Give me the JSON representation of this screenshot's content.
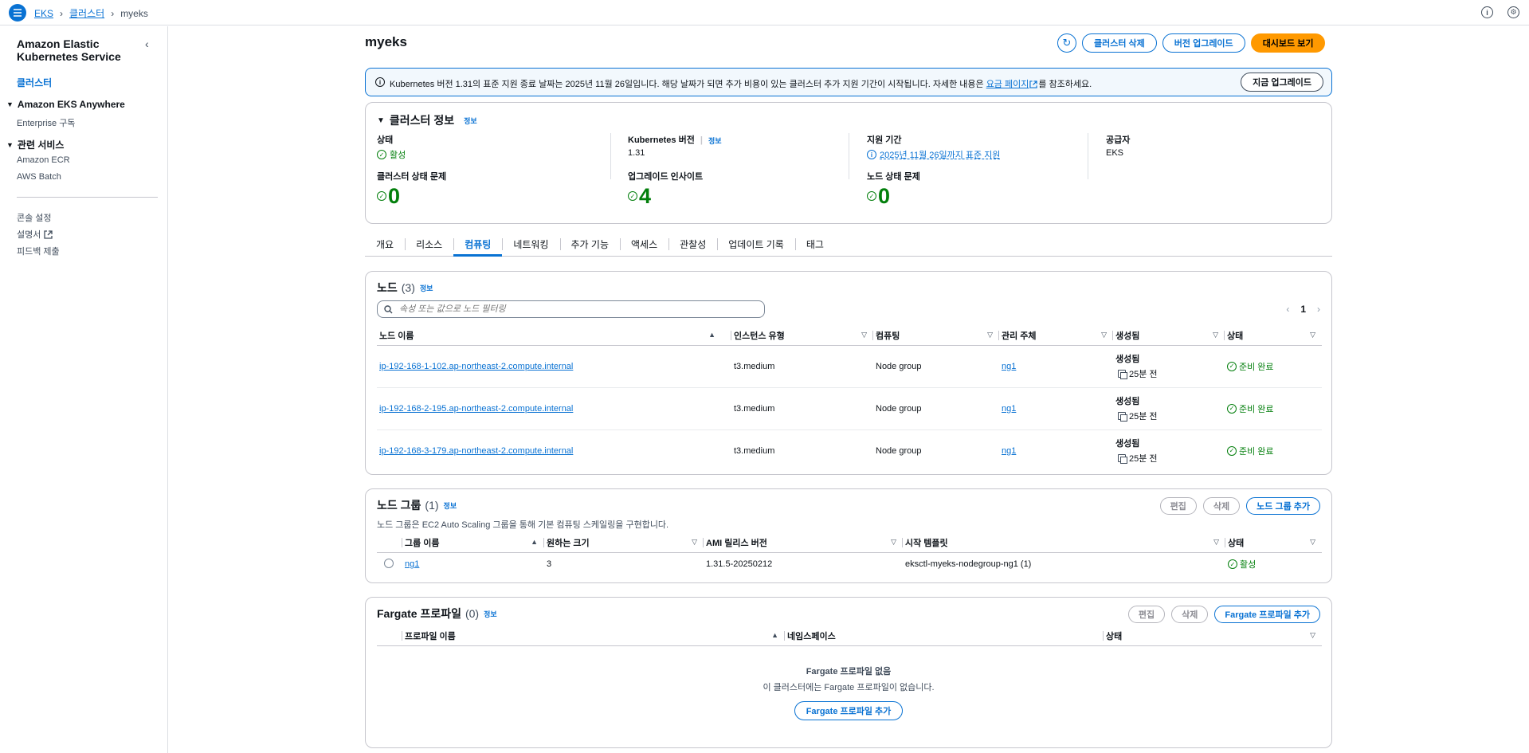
{
  "topbar": {
    "breadcrumb": [
      "EKS",
      "클러스터",
      "myeks"
    ]
  },
  "sidebar": {
    "title": "Amazon Elastic Kubernetes Service",
    "active_link": "클러스터",
    "sections": [
      {
        "label": "Amazon EKS Anywhere",
        "items": [
          "Enterprise 구독"
        ]
      },
      {
        "label": "관련 서비스",
        "items": [
          "Amazon ECR",
          "AWS Batch"
        ]
      }
    ],
    "footer_items": [
      "콘솔 설정",
      "설명서",
      "피드백 제출"
    ]
  },
  "header": {
    "title": "myeks",
    "delete_label": "클러스터 삭제",
    "upgrade_label": "버전 업그레이드",
    "dashboard_label": "대시보드 보기"
  },
  "banner": {
    "text_before": "Kubernetes 버전 1.31의 표준 지원 종료 날짜는 2025년 11월 26일입니다. 해당 날짜가 되면 추가 비용이 있는 클러스터 추가 지원 기간이 시작됩니다. 자세한 내용은 ",
    "link": "요금 페이지",
    "text_after": "를 참조하세요.",
    "button": "지금 업그레이드"
  },
  "cluster_info": {
    "title": "클러스터 정보",
    "info": "정보",
    "status_label": "상태",
    "status_value": "활성",
    "k8s_label": "Kubernetes 버전",
    "k8s_info": "정보",
    "k8s_value": "1.31",
    "support_label": "지원 기간",
    "support_value": "2025년 11월 26일까지 표준 지원",
    "provider_label": "공급자",
    "provider_value": "EKS",
    "health_label": "클러스터 상태 문제",
    "health_value": "0",
    "insights_label": "업그레이드 인사이트",
    "insights_value": "4",
    "node_health_label": "노드 상태 문제",
    "node_health_value": "0"
  },
  "tabs": [
    "개요",
    "리소스",
    "컴퓨팅",
    "네트워킹",
    "추가 기능",
    "액세스",
    "관찰성",
    "업데이트 기록",
    "태그"
  ],
  "active_tab": "컴퓨팅",
  "nodes": {
    "title": "노드",
    "count": "(3)",
    "info": "정보",
    "search_placeholder": "속성 또는 값으로 노드 필터링",
    "page": "1",
    "columns": [
      "노드 이름",
      "인스턴스 유형",
      "컴퓨팅",
      "관리 주체",
      "생성됨",
      "상태"
    ],
    "rows": [
      {
        "name": "ip-192-168-1-102.ap-northeast-2.compute.internal",
        "instance": "t3.medium",
        "compute": "Node group",
        "managed_by": "ng1",
        "created_label": "생성됨",
        "created": "25분 전",
        "status": "준비 완료"
      },
      {
        "name": "ip-192-168-2-195.ap-northeast-2.compute.internal",
        "instance": "t3.medium",
        "compute": "Node group",
        "managed_by": "ng1",
        "created_label": "생성됨",
        "created": "25분 전",
        "status": "준비 완료"
      },
      {
        "name": "ip-192-168-3-179.ap-northeast-2.compute.internal",
        "instance": "t3.medium",
        "compute": "Node group",
        "managed_by": "ng1",
        "created_label": "생성됨",
        "created": "25분 전",
        "status": "준비 완료"
      }
    ]
  },
  "node_groups": {
    "title": "노드 그룹",
    "count": "(1)",
    "info": "정보",
    "description": "노드 그룹은 EC2 Auto Scaling 그룹을 통해 기본 컴퓨팅 스케일링을 구현합니다.",
    "edit": "편집",
    "delete": "삭제",
    "add": "노드 그룹 추가",
    "columns": [
      "그룹 이름",
      "원하는 크기",
      "AMI 릴리스 버전",
      "시작 템플릿",
      "상태"
    ],
    "rows": [
      {
        "name": "ng1",
        "desired": "3",
        "ami": "1.31.5-20250212",
        "template": "eksctl-myeks-nodegroup-ng1 (1)",
        "status": "활성"
      }
    ]
  },
  "fargate": {
    "title": "Fargate 프로파일",
    "count": "(0)",
    "info": "정보",
    "edit": "편집",
    "delete": "삭제",
    "add": "Fargate 프로파일 추가",
    "columns": [
      "프로파일 이름",
      "네임스페이스",
      "상태"
    ],
    "empty_title": "Fargate 프로파일 없음",
    "empty_desc": "이 클러스터에는 Fargate 프로파일이 없습니다.",
    "empty_button": "Fargate 프로파일 추가"
  },
  "colors": {
    "link": "#0972d3",
    "success": "#037f0c",
    "primary_button": "#ff9900"
  }
}
